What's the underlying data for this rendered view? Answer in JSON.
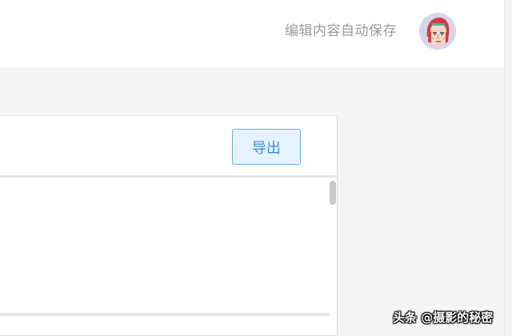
{
  "header": {
    "autosave_text": "编辑内容自动保存",
    "avatar_icon": "user-avatar-icon"
  },
  "panel": {
    "export_label": "导出"
  },
  "watermark": {
    "text": "头条 @摄影的秘密"
  },
  "colors": {
    "accent": "#3a8fd6",
    "button_bg": "#e6f2fd",
    "button_border": "#66aee9",
    "muted_text": "#9a9a9a"
  }
}
